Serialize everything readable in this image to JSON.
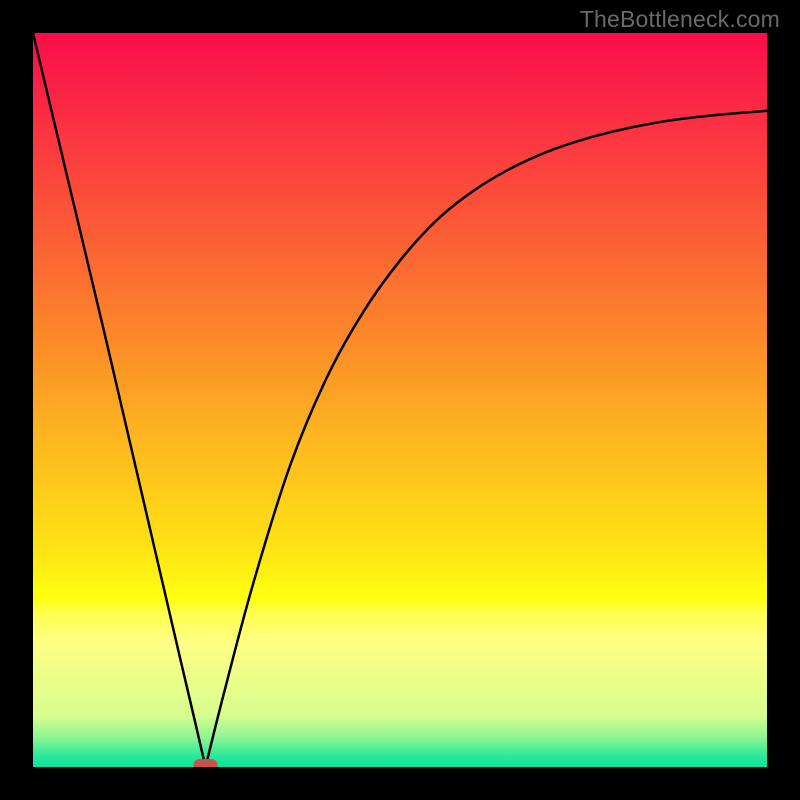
{
  "watermark": "TheBottleneck.com",
  "chart_data": {
    "type": "line",
    "title": "",
    "xlabel": "",
    "ylabel": "",
    "xlim": [
      0,
      100
    ],
    "ylim": [
      0,
      100
    ],
    "grid": false,
    "legend": false,
    "marker": {
      "x": 23.5,
      "y": 0,
      "color": "#c9524b",
      "shape": "pill"
    },
    "series": [
      {
        "name": "left-branch",
        "x": [
          0,
          5,
          10,
          15,
          20,
          22,
          23.5
        ],
        "values": [
          100,
          79,
          58,
          36.5,
          15,
          6.5,
          0
        ]
      },
      {
        "name": "right-branch",
        "x": [
          23.5,
          26,
          30,
          35,
          40,
          45,
          50,
          55,
          60,
          65,
          70,
          75,
          80,
          85,
          90,
          95,
          100
        ],
        "values": [
          0,
          10,
          25,
          41,
          53,
          62,
          69,
          74.5,
          78.5,
          81.5,
          83.8,
          85.5,
          86.8,
          87.8,
          88.5,
          89,
          89.4
        ]
      }
    ],
    "background_gradient": {
      "stops": [
        {
          "pos": 0.0,
          "color": "#fa0d4c"
        },
        {
          "pos": 0.12,
          "color": "#fb2f43"
        },
        {
          "pos": 0.25,
          "color": "#fb5637"
        },
        {
          "pos": 0.4,
          "color": "#fc842b"
        },
        {
          "pos": 0.55,
          "color": "#fdb61f"
        },
        {
          "pos": 0.7,
          "color": "#fee216"
        },
        {
          "pos": 0.77,
          "color": "#ffff10"
        },
        {
          "pos": 0.79,
          "color": "#ffff4e"
        },
        {
          "pos": 0.83,
          "color": "#feff84"
        },
        {
          "pos": 0.93,
          "color": "#d8fd8f"
        },
        {
          "pos": 0.96,
          "color": "#8cf594"
        },
        {
          "pos": 0.985,
          "color": "#2ae999"
        },
        {
          "pos": 1.0,
          "color": "#0ae59b"
        }
      ]
    }
  }
}
